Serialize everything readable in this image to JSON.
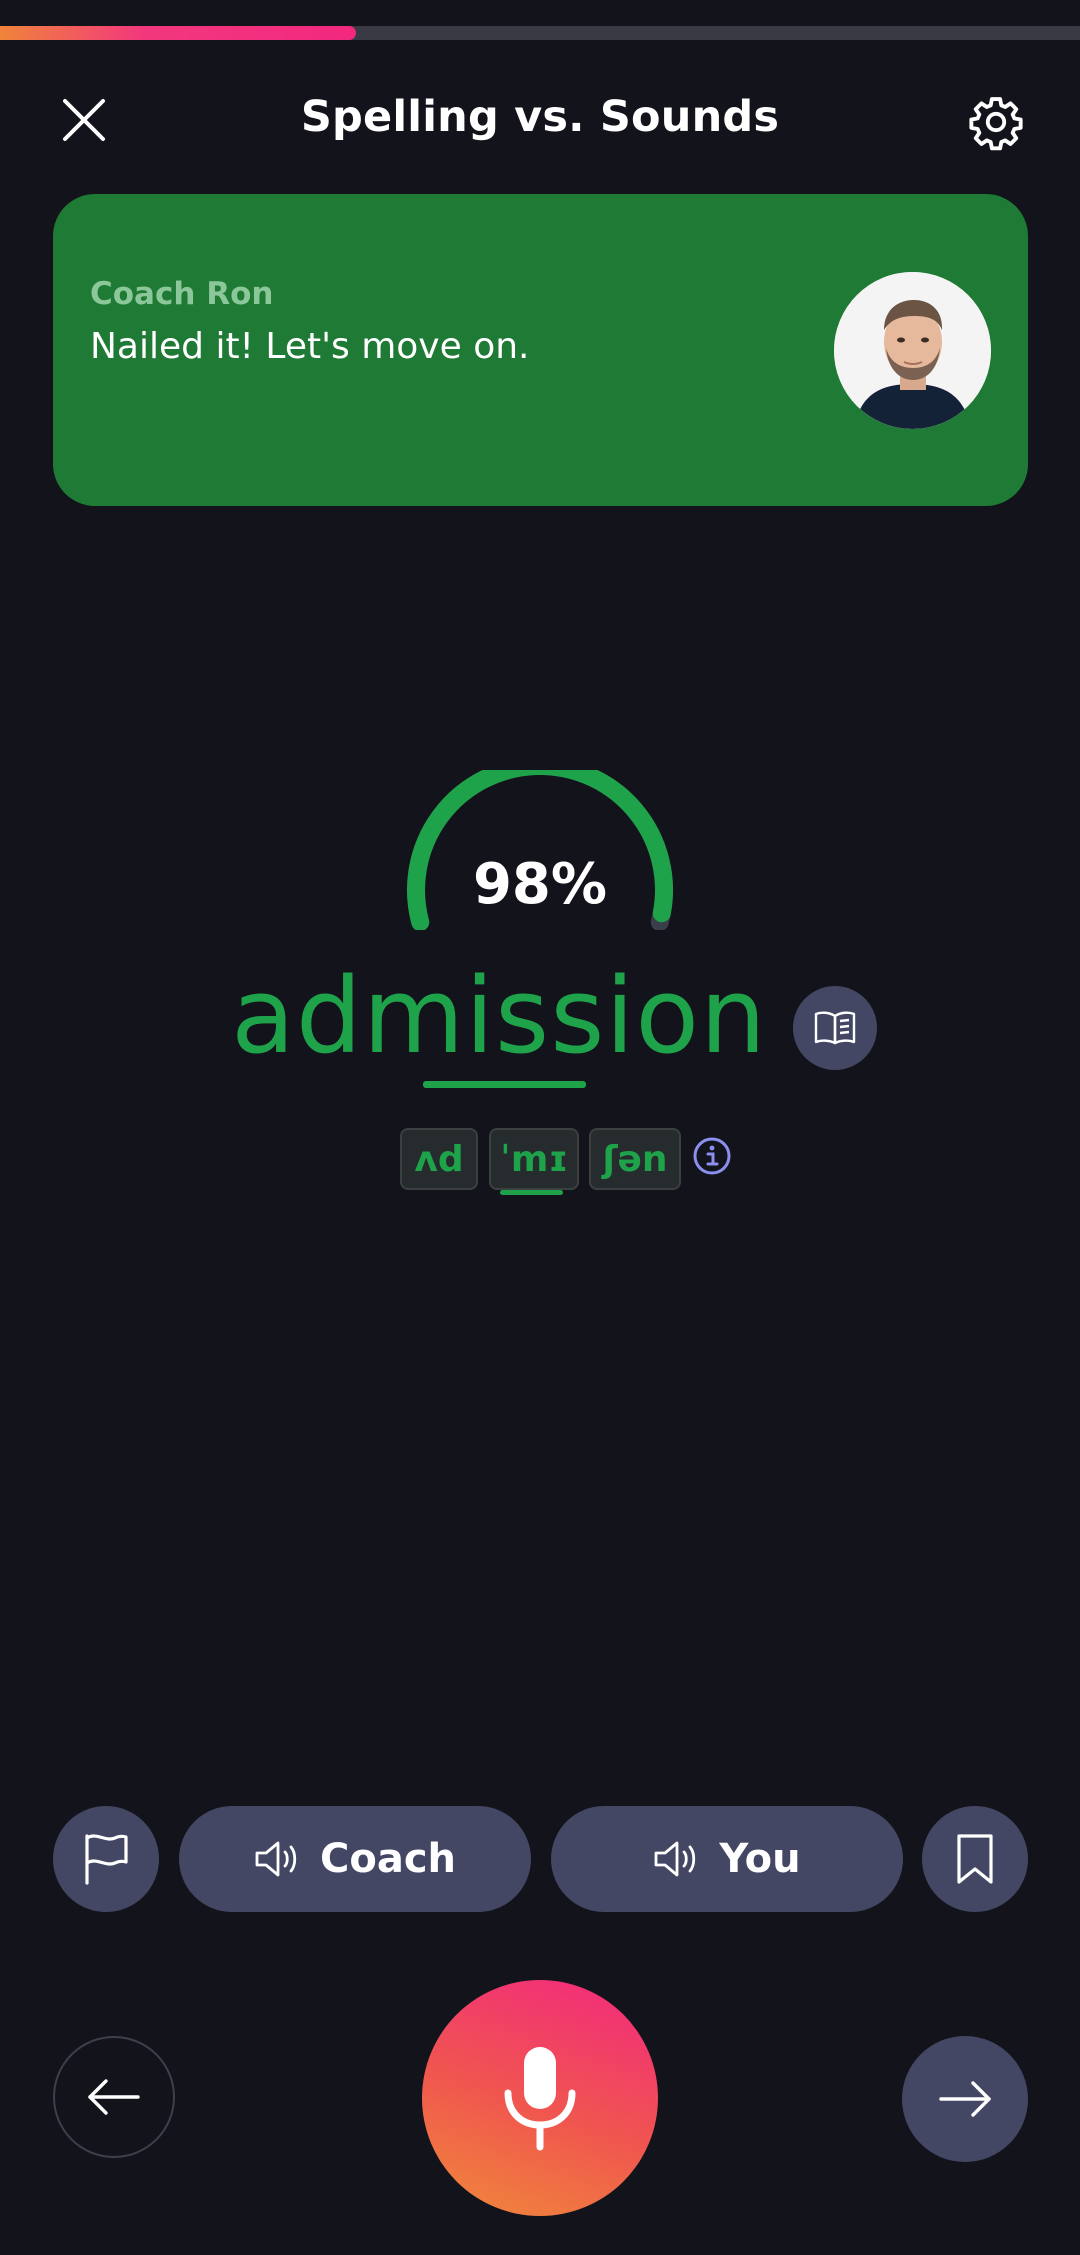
{
  "progress": {
    "fraction": 0.33,
    "color_start": "#f0843a",
    "color_end": "#f2287f"
  },
  "header": {
    "title": "Spelling vs. Sounds",
    "close_icon": "close-icon",
    "settings_icon": "gear-icon"
  },
  "coach_card": {
    "name": "Coach Ron",
    "message": "Nailed it! Let's move on.",
    "background": "#1e7a34",
    "avatar_icon": "coach-avatar"
  },
  "score": {
    "value": 0.98,
    "label": "98%",
    "color": "#1fa34a"
  },
  "word": {
    "text": "admission",
    "color": "#1fa34a",
    "dictionary_icon": "book-icon"
  },
  "ipa": {
    "syllables": [
      "ʌd",
      "ˈmɪ",
      "ʃən"
    ],
    "stressed_index": 1,
    "info_icon": "info-icon"
  },
  "actions": {
    "flag_icon": "flag-icon",
    "coach_label": "Coach",
    "you_label": "You",
    "speaker_icon": "speaker-icon",
    "bookmark_icon": "bookmark-icon"
  },
  "navigation": {
    "back_icon": "arrow-left-icon",
    "mic_icon": "microphone-icon",
    "next_icon": "arrow-right-icon"
  },
  "colors": {
    "background": "#13131b",
    "button": "#444763",
    "accent_green": "#1fa34a",
    "mic_gradient_start": "#f2287f",
    "mic_gradient_end": "#f08a3a"
  }
}
